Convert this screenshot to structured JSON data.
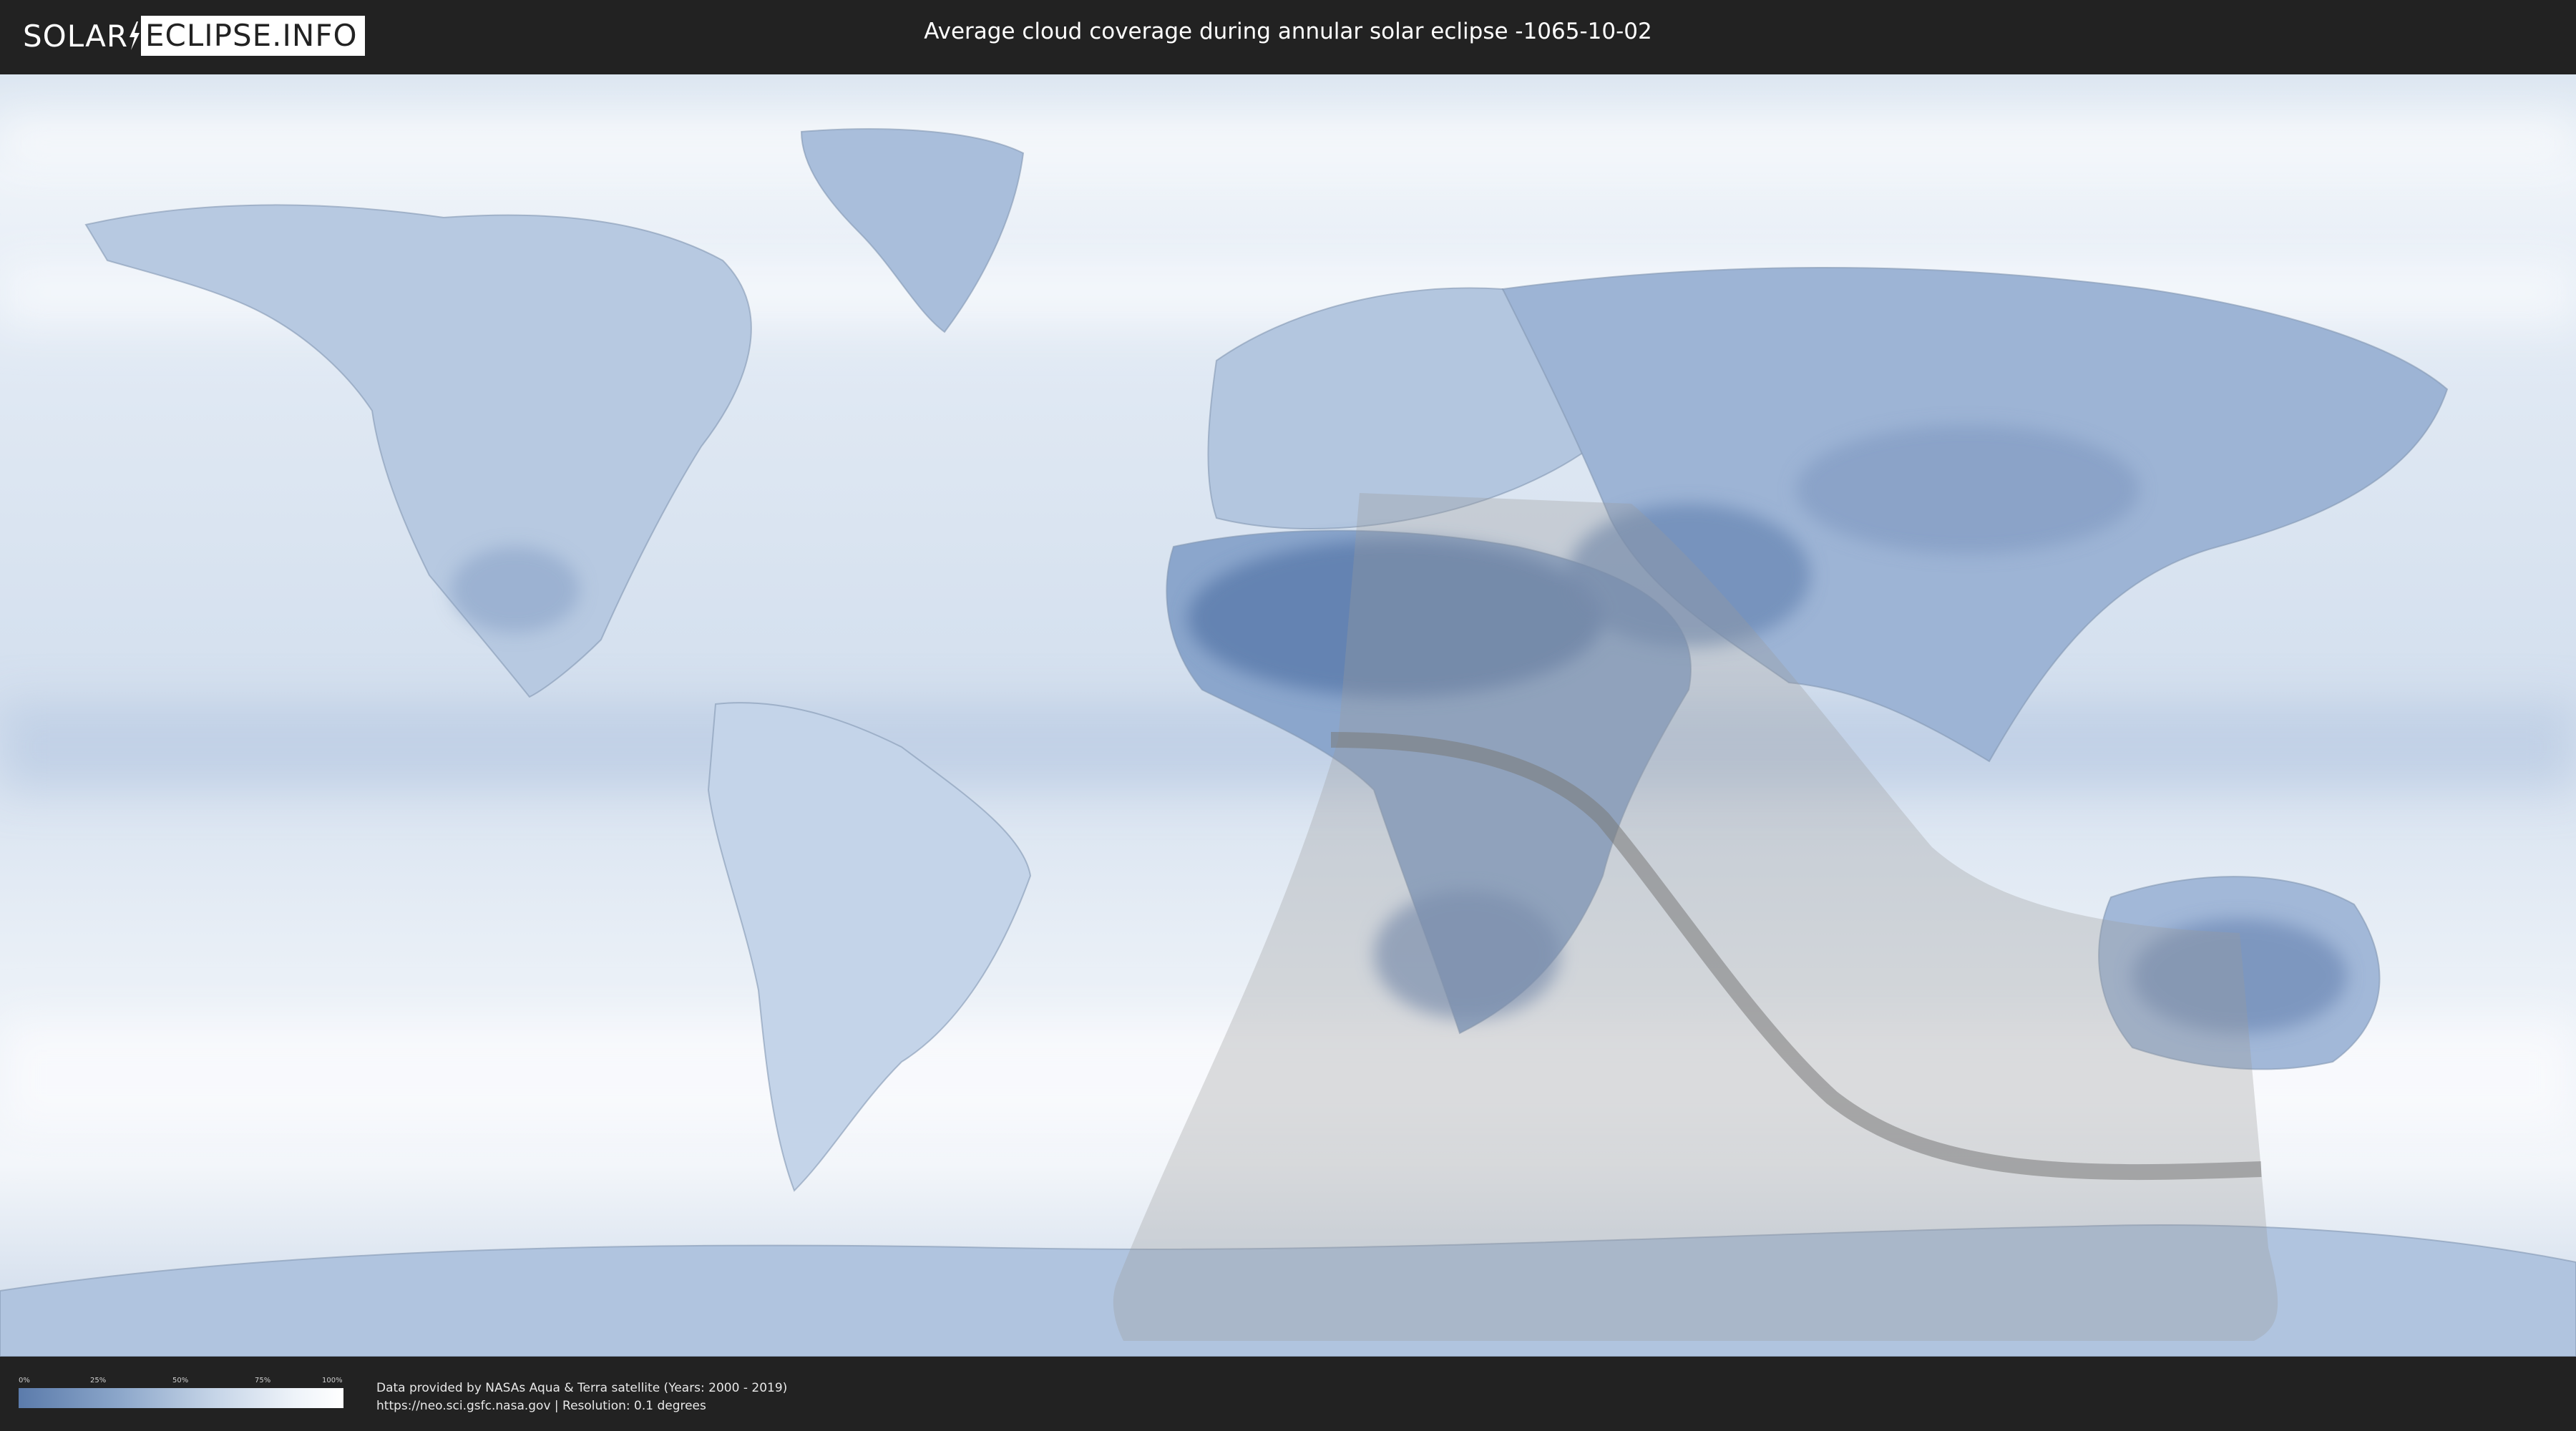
{
  "header": {
    "logo_left": "SOLAR",
    "logo_right": "ECLIPSE.INFO",
    "title": "Average cloud coverage during annular solar eclipse -1065-10-02"
  },
  "map": {
    "type": "world cloud coverage map with eclipse path overlay",
    "colors": {
      "cloud_low": "#5b7bab",
      "cloud_high": "#ffffff",
      "eclipse_shadow": "#9a9a9a",
      "central_line": "#7a7a7a"
    }
  },
  "legend": {
    "ticks": [
      "0%",
      "25%",
      "50%",
      "75%",
      "100%"
    ],
    "colors": [
      "#5b7bab",
      "#ffffff"
    ]
  },
  "footer": {
    "credit_line1": "Data provided by NASAs Aqua & Terra satellite (Years: 2000 - 2019)",
    "credit_line2": "https://neo.sci.gsfc.nasa.gov | Resolution: 0.1 degrees"
  }
}
